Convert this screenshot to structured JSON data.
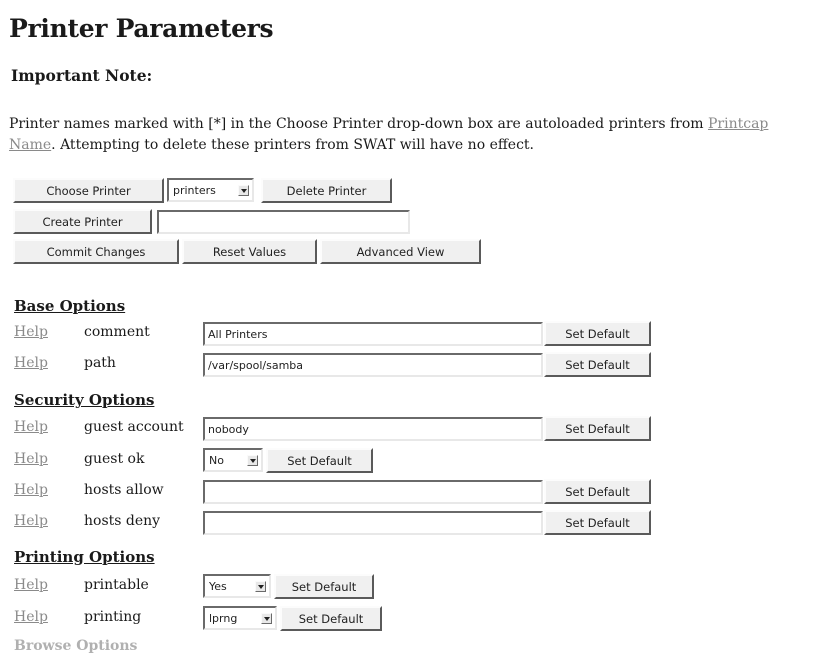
{
  "page": {
    "title": "Printer Parameters",
    "note_heading": "Important Note:",
    "note_line1_pre": "Printer names marked with [*] in the Choose Printer drop-down box are autoloaded printers from ",
    "note_link1": "Printcap",
    "note_link2": "Name",
    "note_line2_post": ". Attempting to delete these printers from SWAT will have no effect."
  },
  "toolbar": {
    "choose_printer": "Choose Printer",
    "printer_select_value": "printers",
    "delete_printer": "Delete Printer",
    "create_printer": "Create Printer",
    "create_printer_value": "",
    "commit_changes": "Commit Changes",
    "reset_values": "Reset Values",
    "advanced_view": "Advanced View"
  },
  "common": {
    "help": "Help",
    "set_default": "Set Default"
  },
  "sections": {
    "base": {
      "title": "Base Options",
      "comment": {
        "label": "comment",
        "value": "All Printers"
      },
      "path": {
        "label": "path",
        "value": "/var/spool/samba"
      }
    },
    "security": {
      "title": "Security Options",
      "guest_account": {
        "label": "guest account",
        "value": "nobody"
      },
      "guest_ok": {
        "label": "guest ok",
        "value": "No"
      },
      "hosts_allow": {
        "label": "hosts allow",
        "value": ""
      },
      "hosts_deny": {
        "label": "hosts deny",
        "value": ""
      }
    },
    "printing": {
      "title": "Printing Options",
      "printable": {
        "label": "printable",
        "value": "Yes"
      },
      "printing": {
        "label": "printing",
        "value": "lprng"
      }
    },
    "browse": {
      "title": "Browse Options"
    }
  }
}
